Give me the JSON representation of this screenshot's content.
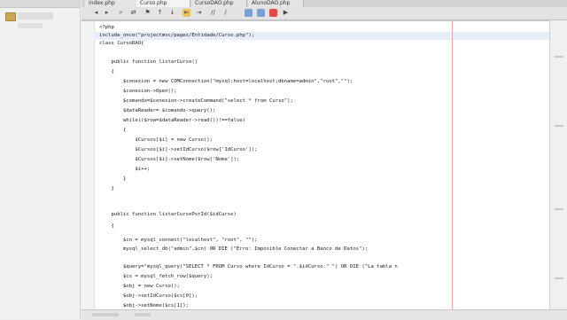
{
  "tabs": [
    {
      "label": "index.php"
    },
    {
      "label": "Curso.php"
    },
    {
      "label": "CursoDAO.php"
    },
    {
      "label": "AlunoDAO.php"
    }
  ],
  "toolbar": {
    "icons": [
      "back-icon",
      "forward-icon",
      "find-icon",
      "replace-icon",
      "toggle-bookmark-icon",
      "prev-bookmark-icon",
      "next-bookmark-icon",
      "shift-left-icon",
      "shift-right-icon",
      "comment-icon",
      "uncomment-icon",
      "record-macro-icon",
      "stop-macro-icon"
    ]
  },
  "editor": {
    "lines": [
      {
        "text": "<?php"
      },
      {
        "text": "include_once(\"projectmvc/pages/Entidade/Curso.php\");"
      },
      {
        "text": "class CursoDAO{"
      },
      {
        "text": ""
      },
      {
        "text": "    public function listarCurso()"
      },
      {
        "text": "    {"
      },
      {
        "text": "        $conexion = new COMConnection(\"mysql:host=localhost;dbname=admin\",\"root\",\"\");"
      },
      {
        "text": "        $conexion->Open();"
      },
      {
        "text": "        $comando=$conexion->createCommand(\"select * from Curso\");"
      },
      {
        "text": "        $dataReader= $comando->query();"
      },
      {
        "text": "        while(($row=$dataReader->read())!==false)"
      },
      {
        "text": "        {"
      },
      {
        "text": "            $Cursos[$i] = new Curso();"
      },
      {
        "text": "            $Cursos[$i]->setIdCurso($row['IdCurso']);"
      },
      {
        "text": "            $Cursos[$i]->setNome($row['Nome']);"
      },
      {
        "text": "            $i++;"
      },
      {
        "text": "        }"
      },
      {
        "text": "    }"
      },
      {
        "text": ""
      },
      {
        "text": "    public function listarCursoPorId($idCurso)"
      },
      {
        "text": "    {"
      },
      {
        "text": ""
      },
      {
        "text": "        $cn = mysql_connect(\"localhost\", \"root\", \"\");"
      },
      {
        "text": "        mysql_select_db(\"admin\",$cn) OR DIE (\"Erro: Imposible Conectar a Banco de Datos\");"
      },
      {
        "text": ""
      },
      {
        "text": "        $query=\"mysql_query(\"SELECT * FROM Curso where IdCurso = \".$idCurso.\" \") OR DIE (\"La tabla n"
      },
      {
        "text": "        $cs = mysql_fetch_row($query);"
      },
      {
        "text": "        $obj = new Curso();"
      },
      {
        "text": "        $obj->setIdCurso($cs[0]);"
      },
      {
        "text": "        $obj->setNome($cs[1]);"
      }
    ]
  }
}
